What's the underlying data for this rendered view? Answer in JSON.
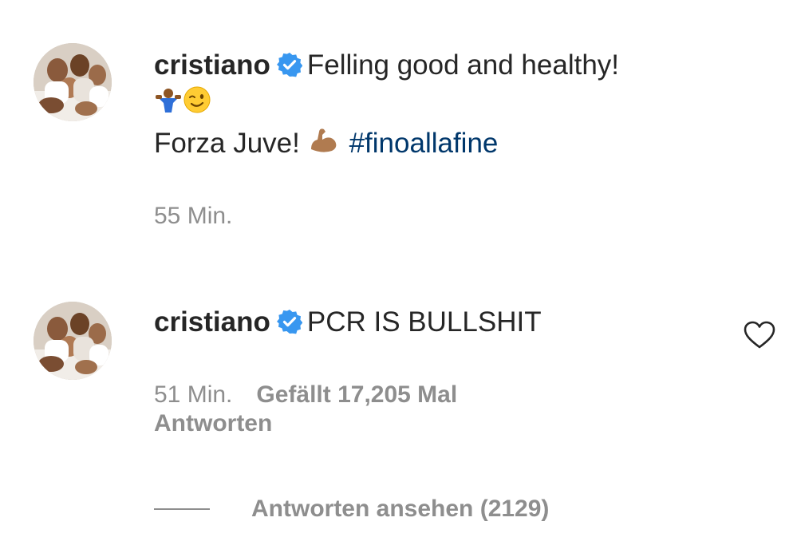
{
  "comments": [
    {
      "username": "cristiano",
      "text": "Felling good and healthy!",
      "line2_emojis": [
        "shrugging-man-emoji",
        "winking-face-emoji"
      ],
      "line3_text": "Forza Juve! ",
      "line3_emoji": "flexed-biceps-emoji",
      "hashtag": "#finoallafine",
      "time": "55 Min."
    },
    {
      "username": "cristiano",
      "text": "PCR IS BULLSHIT",
      "time": "51 Min.",
      "likes": "Gefällt 17,205 Mal",
      "reply": "Antworten",
      "like_icon": "heart-outline-icon"
    }
  ],
  "view_replies": "Antworten ansehen (2129)",
  "colors": {
    "text": "#262626",
    "secondary": "#8e8e8e",
    "hashtag": "#00376b",
    "verified": "#3897f0"
  }
}
